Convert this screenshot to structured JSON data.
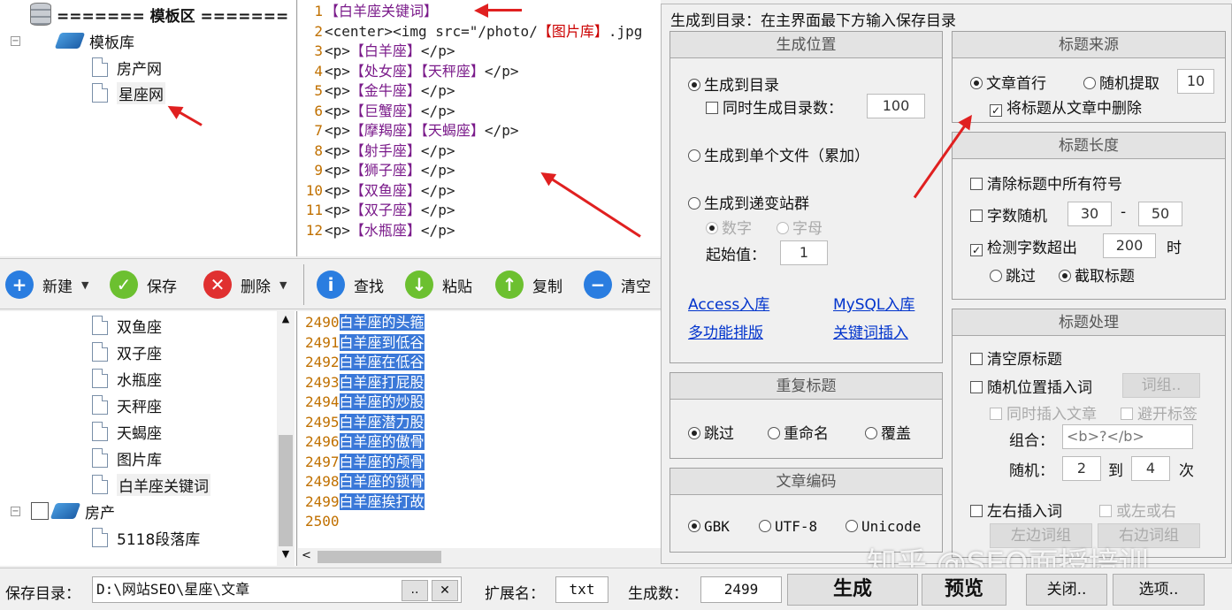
{
  "template_tree": {
    "header": "======= 模板区 =======",
    "items": [
      {
        "label": "模板库"
      },
      {
        "label": "房产网"
      },
      {
        "label": "星座网"
      }
    ]
  },
  "code_editor": {
    "lines": [
      {
        "n": "1",
        "parts": [
          {
            "t": "【白羊座关键词】",
            "c": "kw"
          }
        ]
      },
      {
        "n": "2",
        "parts": [
          {
            "t": "<center><img src=\"/photo/",
            "c": "tag"
          },
          {
            "t": "【图片库】",
            "c": "kwr"
          },
          {
            "t": ".jpg",
            "c": "tag"
          }
        ]
      },
      {
        "n": "3",
        "parts": [
          {
            "t": "<p>",
            "c": "tag"
          },
          {
            "t": "【白羊座】",
            "c": "kw"
          },
          {
            "t": "</p>",
            "c": "tag"
          }
        ]
      },
      {
        "n": "4",
        "parts": [
          {
            "t": "<p>",
            "c": "tag"
          },
          {
            "t": "【处女座】【天秤座】",
            "c": "kw"
          },
          {
            "t": "</p>",
            "c": "tag"
          }
        ]
      },
      {
        "n": "5",
        "parts": [
          {
            "t": "<p>",
            "c": "tag"
          },
          {
            "t": "【金牛座】",
            "c": "kw"
          },
          {
            "t": "</p>",
            "c": "tag"
          }
        ]
      },
      {
        "n": "6",
        "parts": [
          {
            "t": "<p>",
            "c": "tag"
          },
          {
            "t": "【巨蟹座】",
            "c": "kw"
          },
          {
            "t": "</p>",
            "c": "tag"
          }
        ]
      },
      {
        "n": "7",
        "parts": [
          {
            "t": "<p>",
            "c": "tag"
          },
          {
            "t": "【摩羯座】【天蝎座】",
            "c": "kw"
          },
          {
            "t": "</p>",
            "c": "tag"
          }
        ]
      },
      {
        "n": "8",
        "parts": [
          {
            "t": "<p>",
            "c": "tag"
          },
          {
            "t": "【射手座】",
            "c": "kw"
          },
          {
            "t": "</p>",
            "c": "tag"
          }
        ]
      },
      {
        "n": "9",
        "parts": [
          {
            "t": "<p>",
            "c": "tag"
          },
          {
            "t": "【狮子座】",
            "c": "kw"
          },
          {
            "t": "</p>",
            "c": "tag"
          }
        ]
      },
      {
        "n": "10",
        "parts": [
          {
            "t": "<p>",
            "c": "tag"
          },
          {
            "t": "【双鱼座】",
            "c": "kw"
          },
          {
            "t": "</p>",
            "c": "tag"
          }
        ]
      },
      {
        "n": "11",
        "parts": [
          {
            "t": "<p>",
            "c": "tag"
          },
          {
            "t": "【双子座】",
            "c": "kw"
          },
          {
            "t": "</p>",
            "c": "tag"
          }
        ]
      },
      {
        "n": "12",
        "parts": [
          {
            "t": "<p>",
            "c": "tag"
          },
          {
            "t": "【水瓶座】",
            "c": "kw"
          },
          {
            "t": "</p>",
            "c": "tag"
          }
        ]
      }
    ]
  },
  "toolbar": {
    "new": "新建",
    "save": "保存",
    "delete": "删除",
    "find": "查找",
    "paste": "粘贴",
    "copy": "复制",
    "clear": "清空"
  },
  "library_tree": {
    "items": [
      {
        "label": "双鱼座"
      },
      {
        "label": "双子座"
      },
      {
        "label": "水瓶座"
      },
      {
        "label": "天秤座"
      },
      {
        "label": "天蝎座"
      },
      {
        "label": "图片库"
      },
      {
        "label": "白羊座关键词"
      }
    ],
    "group": "房产",
    "group_child": "5118段落库"
  },
  "keyword_list": {
    "rows": [
      {
        "n": "2490",
        "text": "白羊座的头箍"
      },
      {
        "n": "2491",
        "text": "白羊座到低谷"
      },
      {
        "n": "2492",
        "text": "白羊座在低谷"
      },
      {
        "n": "2493",
        "text": "白羊座打屁股"
      },
      {
        "n": "2494",
        "text": "白羊座的炒股"
      },
      {
        "n": "2495",
        "text": "白羊座潜力股"
      },
      {
        "n": "2496",
        "text": "白羊座的傲骨"
      },
      {
        "n": "2497",
        "text": "白羊座的颅骨"
      },
      {
        "n": "2498",
        "text": "白羊座的锁骨"
      },
      {
        "n": "2499",
        "text": "白羊座挨打故"
      },
      {
        "n": "2500",
        "text": ""
      }
    ]
  },
  "dialog": {
    "title": "生成到目录：在主界面最下方输入保存目录",
    "gen_location": {
      "title": "生成位置",
      "to_dir": "生成到目录",
      "also_gen_count": "同时生成目录数：",
      "dir_count": "100",
      "single_file": "生成到单个文件（累加）",
      "site_group": "生成到递变站群",
      "digit": "数字",
      "letter": "字母",
      "start_label": "起始值：",
      "start_value": "1",
      "link_access": "Access入库",
      "link_mysql": "MySQL入库",
      "link_layout": "多功能排版",
      "link_kw_insert": "关键词插入"
    },
    "dup_title": {
      "title": "重复标题",
      "skip": "跳过",
      "rename": "重命名",
      "overwrite": "覆盖"
    },
    "encoding": {
      "title": "文章编码",
      "gbk": "GBK",
      "utf8": "UTF-8",
      "unicode": "Unicode"
    },
    "title_source": {
      "title": "标题来源",
      "first_line": "文章首行",
      "random": "随机提取",
      "random_value": "10",
      "remove_from_article": "将标题从文章中删除"
    },
    "title_length": {
      "title": "标题长度",
      "clear_symbols": "清除标题中所有符号",
      "random_len": "字数随机",
      "min": "30",
      "dash": "-",
      "max": "50",
      "detect_over": "检测字数超出",
      "over_value": "200",
      "when": "时",
      "skip": "跳过",
      "truncate": "截取标题"
    },
    "title_process": {
      "title": "标题处理",
      "clear_original": "清空原标题",
      "random_insert": "随机位置插入词",
      "word_group_btn": "词组..",
      "also_insert_article": "同时插入文章",
      "avoid_tags": "避开标签",
      "combo_label": "组合：",
      "combo_value": "<b>?</b>",
      "random_label": "随机：",
      "rand_from": "2",
      "to": "到",
      "rand_to": "4",
      "times": "次",
      "lr_insert": "左右插入词",
      "left_or_right": "或左或右",
      "left_group": "左边词组",
      "right_group": "右边词组"
    }
  },
  "status_bar": {
    "save_dir_label": "保存目录：",
    "save_dir_value": "D:\\网站SEO\\星座\\文章",
    "browse": "..",
    "clear": "✕",
    "ext_label": "扩展名：",
    "ext_value": "txt",
    "count_label": "生成数：",
    "count_value": "2499",
    "generate": "生成",
    "preview": "预览",
    "close": "关闭..",
    "options": "选项.."
  },
  "watermark": "知乎 @SEO面授培训"
}
